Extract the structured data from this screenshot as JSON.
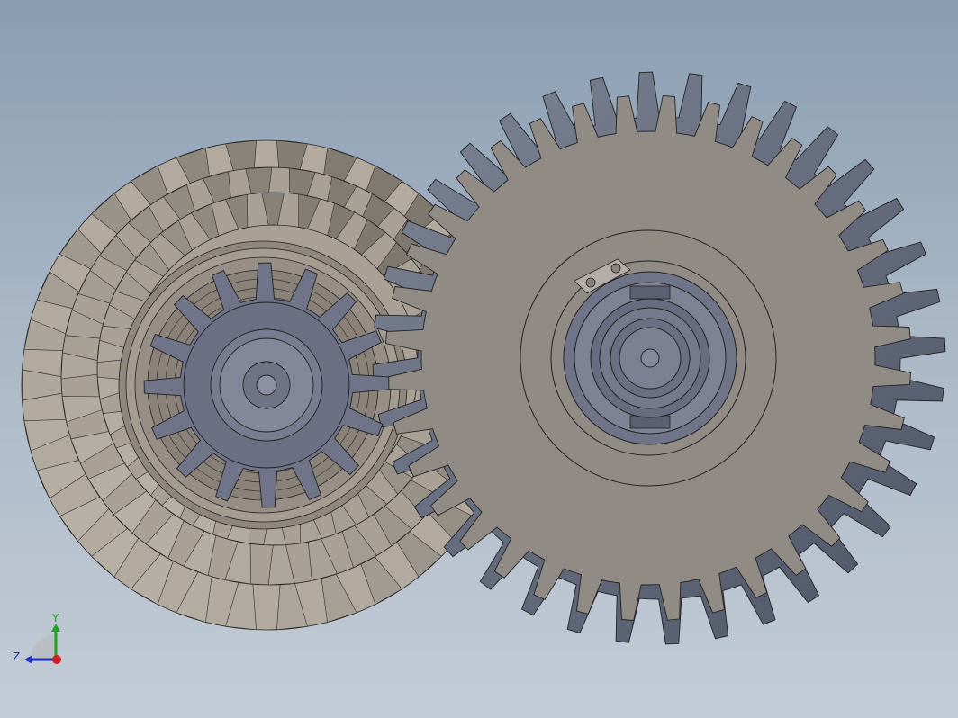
{
  "viewport": {
    "background_top": "#8a9db2",
    "background_bottom": "#c3ccd6"
  },
  "model": {
    "large_spur_gear": {
      "teeth": 36,
      "color_face": "#918b86",
      "color_teeth": "#6c7486"
    },
    "bevel_gear_stack": {
      "rings": 3,
      "teeth_per_ring": 30,
      "color": "#a69d92"
    },
    "pinion": {
      "teeth": 16,
      "color": "#6f7488"
    }
  },
  "triad": {
    "y_label": "Y",
    "z_label": "Z",
    "y_color": "#1fa21f",
    "z_color": "#1f2fbf",
    "origin_color": "#d21e1e"
  }
}
